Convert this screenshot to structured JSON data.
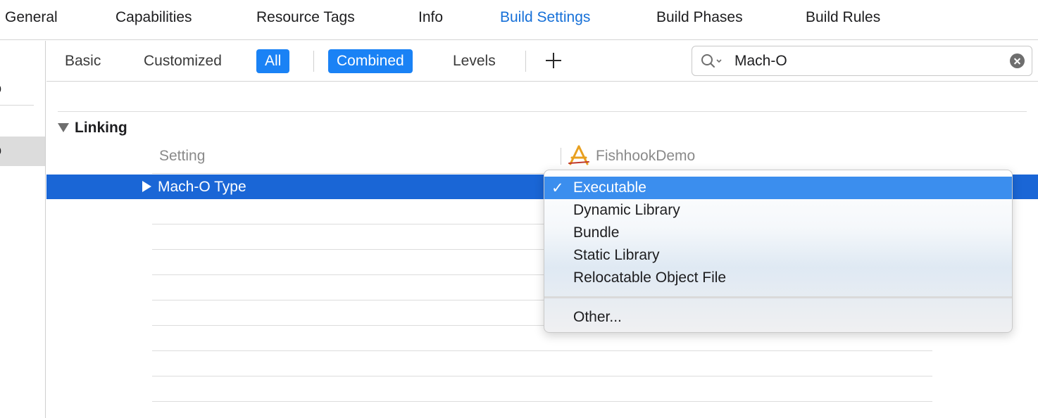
{
  "tabs": [
    {
      "label": "General"
    },
    {
      "label": "Capabilities"
    },
    {
      "label": "Resource Tags"
    },
    {
      "label": "Info"
    },
    {
      "label": "Build Settings",
      "active": true
    },
    {
      "label": "Build Phases"
    },
    {
      "label": "Build Rules"
    }
  ],
  "sidebar": {
    "items": [
      {
        "label": "o"
      },
      {
        "label": "o",
        "selected": true
      }
    ]
  },
  "filters": {
    "basic": "Basic",
    "customized": "Customized",
    "all": "All",
    "combined": "Combined",
    "levels": "Levels",
    "add_icon": "plus-icon"
  },
  "search": {
    "value": "Mach-O",
    "icon": "search-icon",
    "clear_icon": "clear-icon"
  },
  "section": {
    "title": "Linking",
    "column_setting": "Setting",
    "target_name": "FishhookDemo",
    "target_icon": "app-target-icon"
  },
  "selected_row": {
    "label": "Mach-O Type"
  },
  "popup": {
    "items": [
      "Executable",
      "Dynamic Library",
      "Bundle",
      "Static Library",
      "Relocatable Object File"
    ],
    "checked_index": 0,
    "other": "Other...",
    "check_mark": "✓"
  },
  "colors": {
    "accent": "#1a82f5",
    "active_tab": "#1670d8",
    "selected_row": "#1a66d6",
    "menu_highlight": "#3b8eee"
  }
}
